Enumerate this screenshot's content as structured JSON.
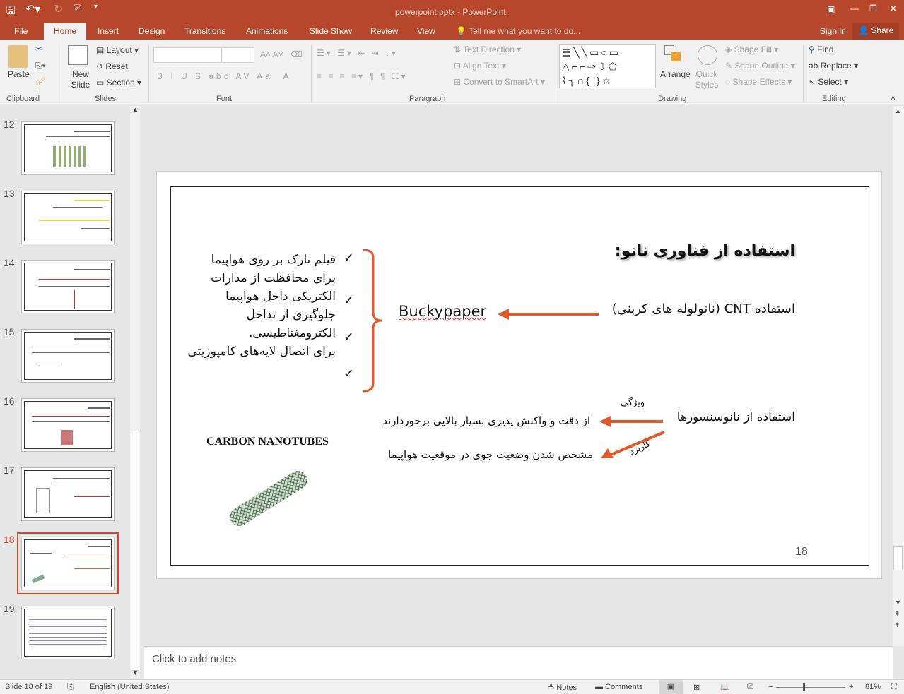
{
  "window": {
    "title": "powerpoint.pptx - PowerPoint"
  },
  "tabs": [
    "File",
    "Home",
    "Insert",
    "Design",
    "Transitions",
    "Animations",
    "Slide Show",
    "Review",
    "View"
  ],
  "tell_me": "Tell me what you want to do...",
  "sign_in": "Sign in",
  "share": "Share",
  "ribbon": {
    "clipboard": {
      "paste": "Paste",
      "label": "Clipboard"
    },
    "slides": {
      "new_slide": "New Slide",
      "layout": "Layout",
      "reset": "Reset",
      "section": "Section",
      "label": "Slides"
    },
    "font": {
      "label": "Font"
    },
    "paragraph": {
      "text_direction": "Text Direction",
      "align_text": "Align Text",
      "convert": "Convert to SmartArt",
      "label": "Paragraph"
    },
    "drawing": {
      "arrange": "Arrange",
      "quick_styles": "Quick Styles",
      "shape_fill": "Shape Fill",
      "shape_outline": "Shape Outline",
      "shape_effects": "Shape Effects",
      "label": "Drawing"
    },
    "editing": {
      "find": "Find",
      "replace": "Replace",
      "select": "Select",
      "label": "Editing"
    }
  },
  "thumbnails": [
    "12",
    "13",
    "14",
    "15",
    "16",
    "17",
    "18",
    "19"
  ],
  "selected_slide": "18",
  "slide": {
    "title": "استفاده از فناوری نانو:",
    "cnt_line": "استفاده CNT (نانولوله های کربنی)",
    "buckypaper": "Buckypaper",
    "bullets": [
      "فیلم نازک بر روی هواپیما",
      "برای محافظت از مدارات الکتریکی داخل هواپیما",
      "جلوگیری از تداخل الکترومغناطیسی.",
      "برای اتصال لایه‌های کامپوزیتی"
    ],
    "nanosensors": "استفاده از نانوسنسورها",
    "feature_label": "ویژگی",
    "feature_text": "از دقت و واکنش پذیری بسیار بالایی برخوردارند",
    "usage_label": "کاربرد",
    "usage_text": "مشخص شدن وضعیت جوی در موقعیت هواپیما",
    "carbon_label": "CARBON NANOTUBES",
    "page_number": "18",
    "accent": "#e05a2b"
  },
  "notes_placeholder": "Click to add notes",
  "status": {
    "slide": "Slide 18 of 19",
    "language": "English (United States)",
    "notes": "Notes",
    "comments": "Comments",
    "zoom": "81%"
  }
}
